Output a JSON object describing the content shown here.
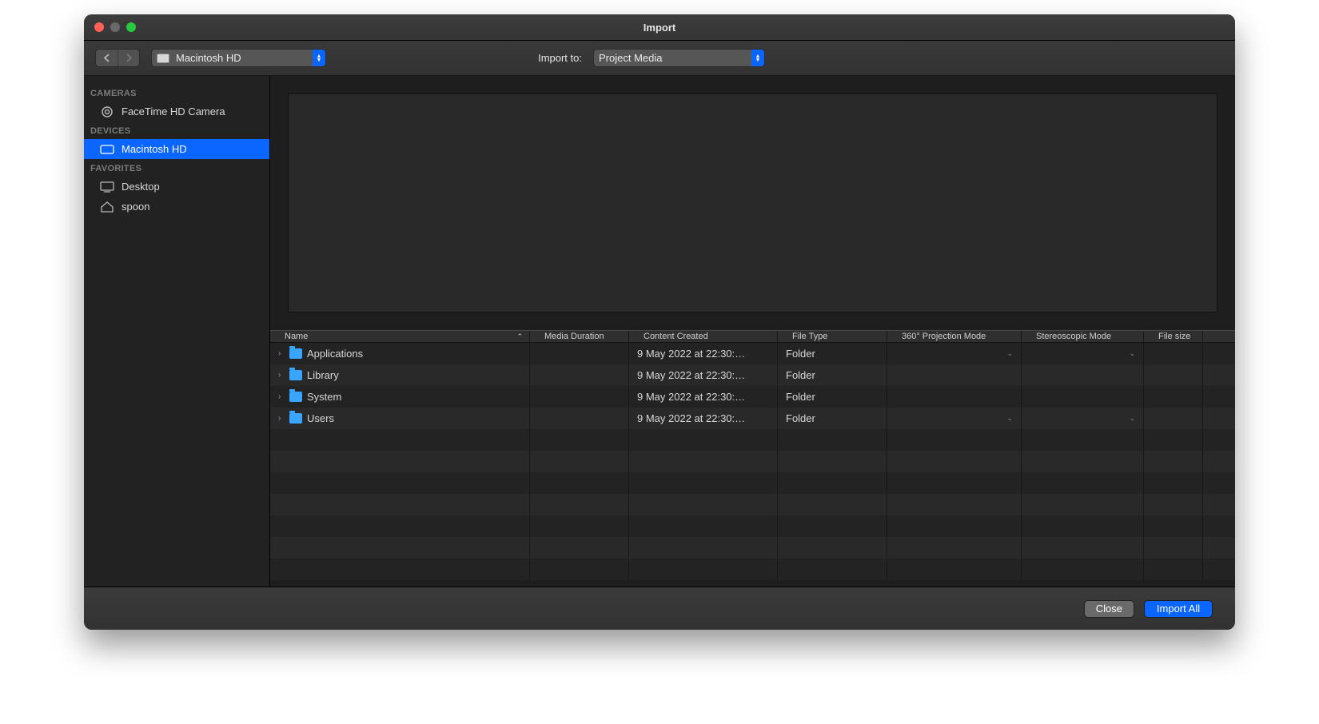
{
  "window": {
    "title": "Import"
  },
  "toolbar": {
    "location": "Macintosh HD",
    "import_to_label": "Import to:",
    "destination": "Project Media"
  },
  "sidebar": {
    "sections": [
      {
        "header": "CAMERAS",
        "items": [
          {
            "label": "FaceTime HD Camera",
            "icon": "camera-target-icon",
            "selected": false
          }
        ]
      },
      {
        "header": "DEVICES",
        "items": [
          {
            "label": "Macintosh HD",
            "icon": "hd-icon",
            "selected": true
          }
        ]
      },
      {
        "header": "FAVORITES",
        "items": [
          {
            "label": "Desktop",
            "icon": "desktop-icon",
            "selected": false
          },
          {
            "label": "spoon",
            "icon": "home-icon",
            "selected": false
          }
        ]
      }
    ]
  },
  "table": {
    "columns": [
      {
        "key": "name",
        "label": "Name",
        "sorted": true
      },
      {
        "key": "dur",
        "label": "Media Duration"
      },
      {
        "key": "created",
        "label": "Content Created"
      },
      {
        "key": "ftype",
        "label": "File Type"
      },
      {
        "key": "p360",
        "label": "360° Projection Mode"
      },
      {
        "key": "stereo",
        "label": "Stereoscopic Mode"
      },
      {
        "key": "size",
        "label": "File size"
      }
    ],
    "rows": [
      {
        "name": "Applications",
        "created": "9 May 2022 at 22:30:…",
        "ftype": "Folder",
        "has_dd": true
      },
      {
        "name": "Library",
        "created": "9 May 2022 at 22:30:…",
        "ftype": "Folder",
        "has_dd": false
      },
      {
        "name": "System",
        "created": "9 May 2022 at 22:30:…",
        "ftype": "Folder",
        "has_dd": false
      },
      {
        "name": "Users",
        "created": "9 May 2022 at 22:30:…",
        "ftype": "Folder",
        "has_dd": true
      }
    ]
  },
  "footer": {
    "close_label": "Close",
    "import_label": "Import All"
  }
}
